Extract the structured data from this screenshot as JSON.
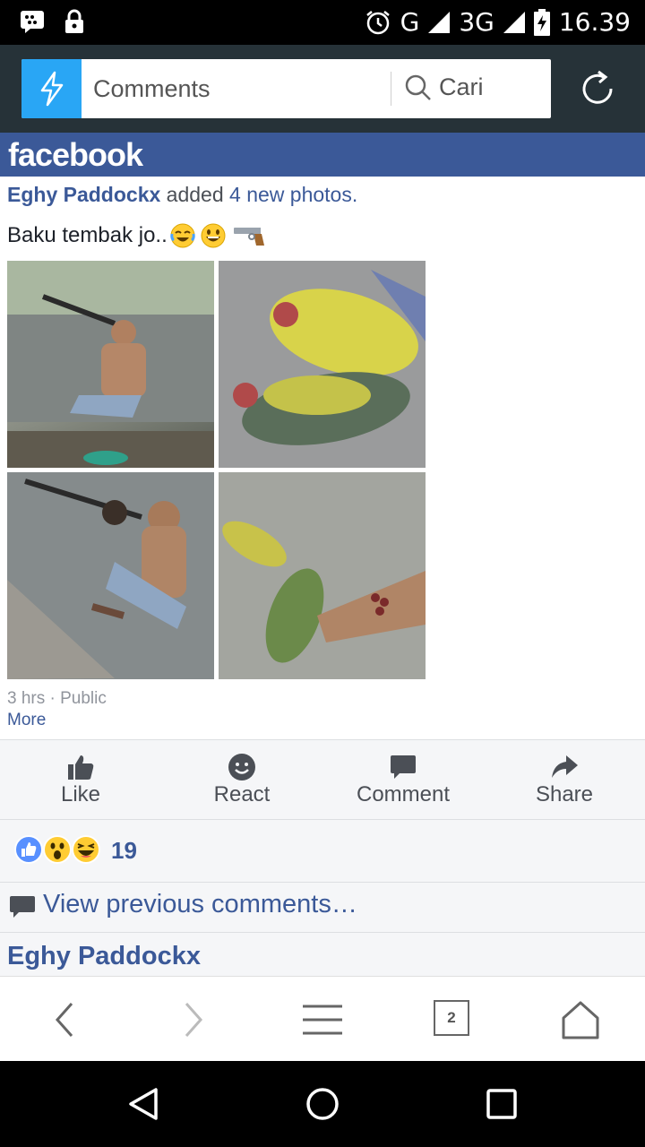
{
  "status_bar": {
    "network_1": "G",
    "network_2": "3G",
    "network_2_sup": "3G",
    "time": "16.39"
  },
  "browser": {
    "url_text": "Comments",
    "search_label": "Cari"
  },
  "facebook": {
    "logo": "facebook"
  },
  "post": {
    "author": "Eghy Paddockx",
    "action_prefix": "added",
    "action_link": "4 new photos",
    "action_suffix": ".",
    "text": "Baku tembak jo..",
    "emojis": [
      "laughing-tears-emoji",
      "grinning-emoji",
      "pistol-emoji"
    ],
    "meta": "3 hrs · Public",
    "more": "More"
  },
  "actions": [
    {
      "label": "Like",
      "icon": "thumbs-up-icon"
    },
    {
      "label": "React",
      "icon": "smiley-icon"
    },
    {
      "label": "Comment",
      "icon": "comment-icon"
    },
    {
      "label": "Share",
      "icon": "share-arrow-icon"
    }
  ],
  "reactions": {
    "icons": [
      "like-reaction-icon",
      "wow-reaction-icon",
      "haha-reaction-icon"
    ],
    "count": "19"
  },
  "comments": {
    "view_previous": "View previous comments…",
    "first_commenter": "Eghy Paddockx"
  },
  "toolbar": {
    "tab_count": "2"
  },
  "colors": {
    "facebook_blue": "#3b5998",
    "browser_bar": "#263238",
    "flash_blue": "#29a6f5"
  }
}
